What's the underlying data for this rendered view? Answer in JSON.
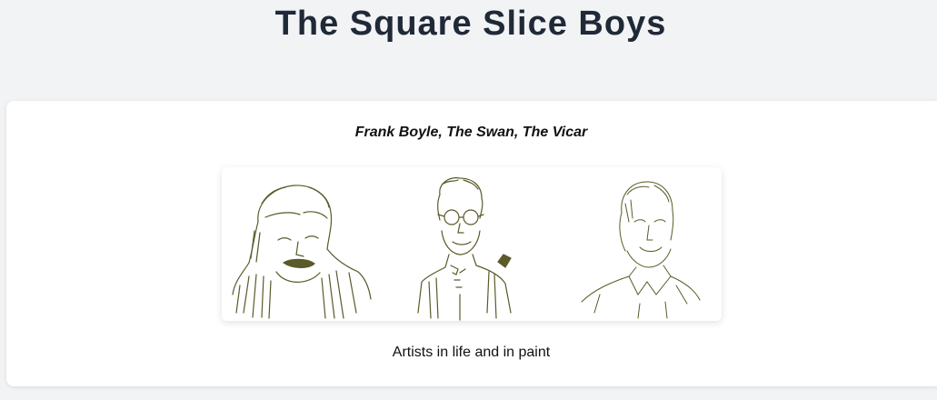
{
  "header": {
    "title": "The Square Slice Boys"
  },
  "feature": {
    "heading": "Frank Boyle, The Swan, The Vicar",
    "caption": "Artists in life and in paint",
    "portraits": [
      "sketch-portrait-1",
      "sketch-portrait-2",
      "sketch-portrait-3"
    ],
    "sketch_color": "#5a5a2a"
  }
}
